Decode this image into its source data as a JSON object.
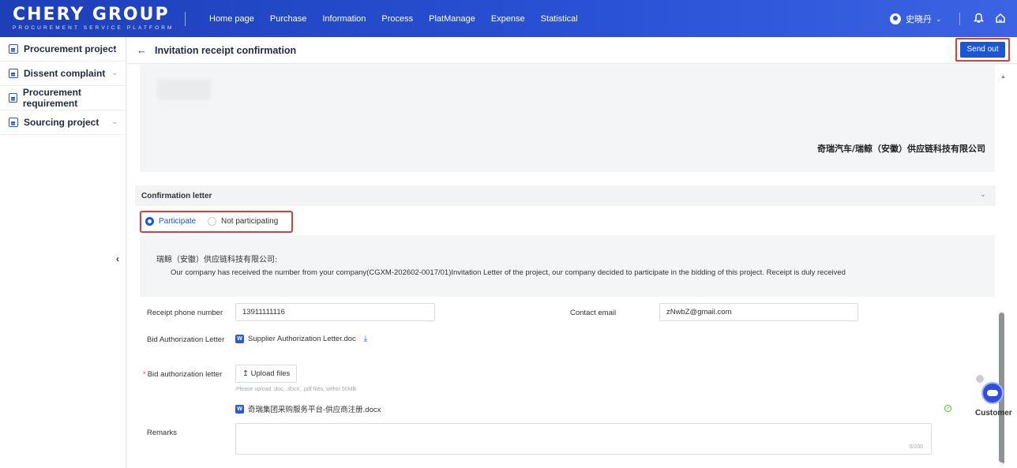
{
  "brand": {
    "name": "CHERY GROUP",
    "tagline": "PROCUREMENT SERVICE PLATFORM"
  },
  "nav": [
    "Home page",
    "Purchase",
    "Information",
    "Process",
    "PlatManage",
    "Expense",
    "Statistical"
  ],
  "user": {
    "name": "史晓丹"
  },
  "sidebar": {
    "items": [
      {
        "label": "Procurement project",
        "expandable": true
      },
      {
        "label": "Dissent complaint",
        "expandable": true
      },
      {
        "label": "Procurement requirement",
        "expandable": false
      },
      {
        "label": "Sourcing project",
        "expandable": true
      }
    ]
  },
  "header": {
    "title": "Invitation receipt confirmation",
    "send_label": "Send out"
  },
  "letter": {
    "company": "奇瑞汽车/瑞鲸（安徽）供应链科技有限公司"
  },
  "confirmation": {
    "section_title": "Confirmation letter",
    "participate": "Participate",
    "not_participating": "Not participating",
    "selected": "Participate",
    "salutation": "瑞鲸（安徽）供应链科技有限公司:",
    "body": "Our company has received the number from your company(CGXM-202602-0017/01)Invitation Letter of the project, our company decided to participate in the bidding of this project. Receipt is duly received"
  },
  "form": {
    "phone_label": "Receipt phone number",
    "phone_value": "13911111116",
    "email_label": "Contact email",
    "email_value": "zNwbZ@gmail.com",
    "auth_letter_label": "Bid Authorization Letter",
    "auth_letter_file": "Supplier Authorization Letter.doc",
    "bid_auth_label": "Bid authorization letter",
    "upload_label": "Upload files",
    "upload_hint": "Please upload .doc, .docx, .pdf files, within 50MB",
    "uploaded_file": "奇瑞集团采购服务平台-供应商注册.docx",
    "remarks_label": "Remarks",
    "remarks_counter": "0/200"
  },
  "assistant": {
    "label": "Customer"
  },
  "colors": {
    "primary": "#1a56d6",
    "highlight": "#e23b3b",
    "topbar": "#2a52d6"
  }
}
